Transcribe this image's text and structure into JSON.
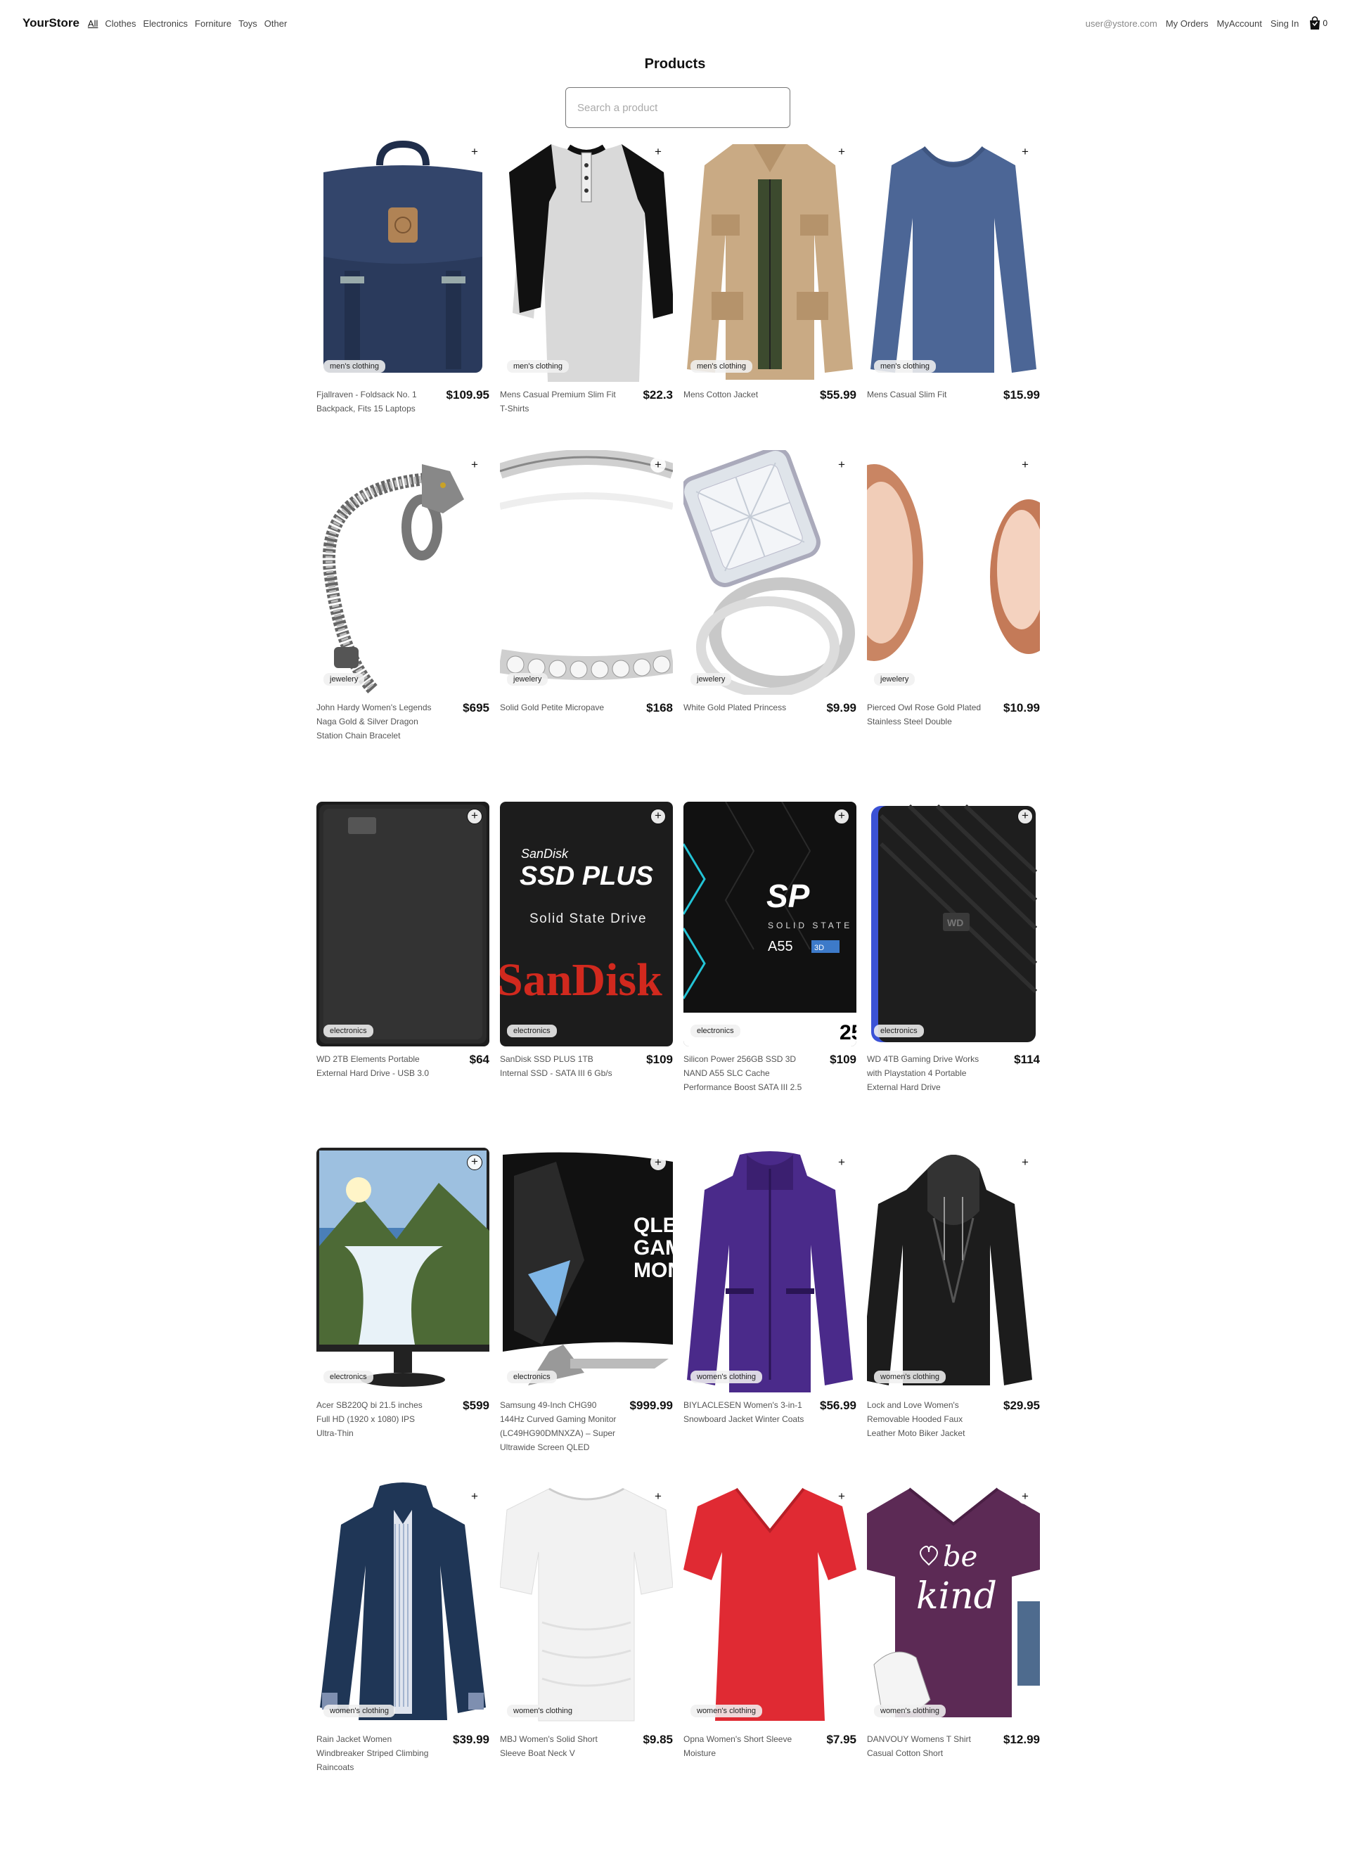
{
  "nav": {
    "brand": "YourStore",
    "categories": [
      "All",
      "Clothes",
      "Electronics",
      "Forniture",
      "Toys",
      "Other"
    ],
    "user_email": "user@ystore.com",
    "my_orders": "My Orders",
    "my_account": "MyAccount",
    "sign_in": "Sing In",
    "cart_count": "0"
  },
  "page": {
    "title": "Products",
    "search_placeholder": "Search a product"
  },
  "products": [
    {
      "name": "Fjallraven - Foldsack No. 1 Backpack, Fits 15 Laptops",
      "price": "$109.95",
      "category": "men's clothing",
      "icon": "backpack"
    },
    {
      "name": "Mens Casual Premium Slim Fit T-Shirts",
      "price": "$22.3",
      "category": "men's clothing",
      "icon": "raglan-tshirt"
    },
    {
      "name": "Mens Cotton Jacket",
      "price": "$55.99",
      "category": "men's clothing",
      "icon": "cotton-jacket"
    },
    {
      "name": "Mens Casual Slim Fit",
      "price": "$15.99",
      "category": "men's clothing",
      "icon": "longsleeve-shirt"
    },
    {
      "name": "John Hardy Women's Legends Naga Gold & Silver Dragon Station Chain Bracelet",
      "price": "$695",
      "category": "jewelery",
      "icon": "dragon-bracelet"
    },
    {
      "name": "Solid Gold Petite Micropave",
      "price": "$168",
      "category": "jewelery",
      "icon": "micropave-ring"
    },
    {
      "name": "White Gold Plated Princess",
      "price": "$9.99",
      "category": "jewelery",
      "icon": "princess-ring"
    },
    {
      "name": "Pierced Owl Rose Gold Plated Stainless Steel Double",
      "price": "$10.99",
      "category": "jewelery",
      "icon": "rose-gold-plugs"
    },
    {
      "name": "WD 2TB Elements Portable External Hard Drive - USB 3.0",
      "price": "$64",
      "category": "electronics",
      "icon": "hard-drive"
    },
    {
      "name": "SanDisk SSD PLUS 1TB Internal SSD - SATA III 6 Gb/s",
      "price": "$109",
      "category": "electronics",
      "icon": "sandisk-ssd",
      "img_text": [
        "SanDisk",
        "SSD PLUS",
        "Solid State Drive",
        "SanDisk"
      ]
    },
    {
      "name": "Silicon Power 256GB SSD 3D NAND A55 SLC Cache Performance Boost SATA III 2.5",
      "price": "$109",
      "category": "electronics",
      "icon": "sp-ssd",
      "img_text": [
        "SP",
        "SOLID STATE",
        "A55",
        "3D",
        "25"
      ]
    },
    {
      "name": "WD 4TB Gaming Drive Works with Playstation 4 Portable External Hard Drive",
      "price": "$114",
      "category": "electronics",
      "icon": "gaming-drive",
      "img_text": [
        "WD"
      ]
    },
    {
      "name": "Acer SB220Q bi 21.5 inches Full HD (1920 x 1080) IPS Ultra-Thin",
      "price": "$599",
      "category": "electronics",
      "icon": "monitor-landscape"
    },
    {
      "name": "Samsung 49-Inch CHG90 144Hz Curved Gaming Monitor (LC49HG90DMNXZA) – Super Ultrawide Screen QLED",
      "price": "$999.99",
      "category": "electronics",
      "icon": "curved-monitor",
      "img_text": [
        "QLED",
        "GAM",
        "MON"
      ]
    },
    {
      "name": "BIYLACLESEN Women's 3-in-1 Snowboard Jacket Winter Coats",
      "price": "$56.99",
      "category": "women's clothing",
      "icon": "snowboard-jacket"
    },
    {
      "name": "Lock and Love Women's Removable Hooded Faux Leather Moto Biker Jacket",
      "price": "$29.95",
      "category": "women's clothing",
      "icon": "leather-jacket"
    },
    {
      "name": "Rain Jacket Women Windbreaker Striped Climbing Raincoats",
      "price": "$39.99",
      "category": "women's clothing",
      "icon": "rain-jacket"
    },
    {
      "name": "MBJ Women's Solid Short Sleeve Boat Neck V",
      "price": "$9.85",
      "category": "women's clothing",
      "icon": "white-top"
    },
    {
      "name": "Opna Women's Short Sleeve Moisture",
      "price": "$7.95",
      "category": "women's clothing",
      "icon": "red-tshirt"
    },
    {
      "name": "DANVOUY Womens T Shirt Casual Cotton Short",
      "price": "$12.99",
      "category": "women's clothing",
      "icon": "be-kind-tshirt",
      "img_text": [
        "be",
        "kind"
      ]
    }
  ]
}
